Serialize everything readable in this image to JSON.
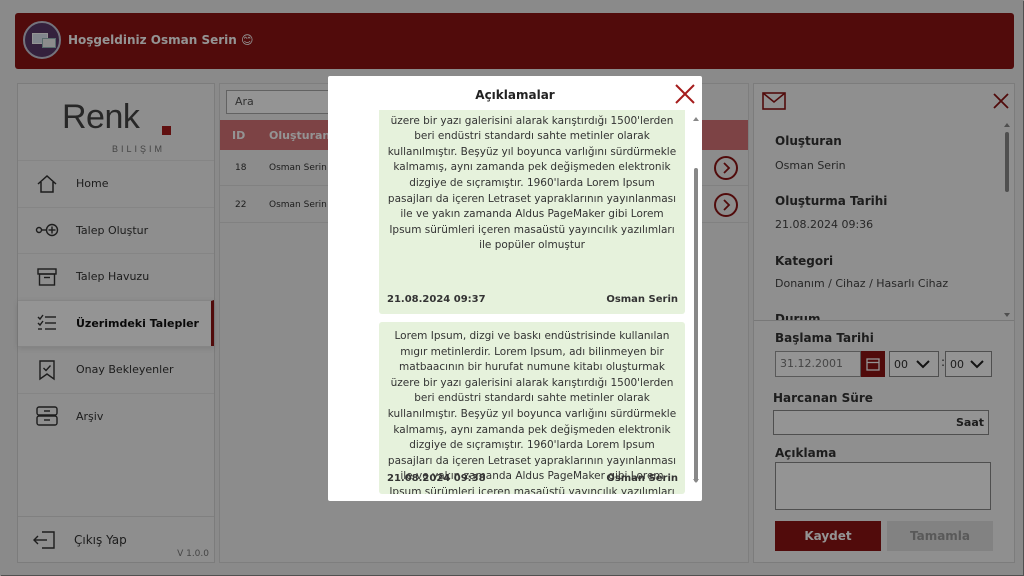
{
  "header": {
    "welcome": "Hoşgeldiniz Osman Serin 😊"
  },
  "logo": {
    "main": "Renk",
    "sub": "BILIŞIM"
  },
  "sidebar": {
    "items": [
      {
        "label": "Home",
        "icon": "home-icon"
      },
      {
        "label": "Talep Oluştur",
        "icon": "create-request-icon"
      },
      {
        "label": "Talep Havuzu",
        "icon": "archive-box-icon"
      },
      {
        "label": "Üzerimdeki Talepler",
        "icon": "task-list-icon",
        "active": true
      },
      {
        "label": "Onay Bekleyenler",
        "icon": "bookmark-check-icon"
      },
      {
        "label": "Arşiv",
        "icon": "inbox-stack-icon"
      }
    ],
    "logout": "Çıkış Yap",
    "version": "V 1.0.0"
  },
  "list": {
    "search_placeholder": "Ara",
    "columns": [
      "ID",
      "Oluşturan"
    ],
    "rows": [
      {
        "id": "18",
        "owner": "Osman Serin"
      },
      {
        "id": "22",
        "owner": "Osman Serin"
      }
    ]
  },
  "detail": {
    "creator_label": "Oluşturan",
    "creator_value": "Osman Serin",
    "created_label": "Oluşturma Tarihi",
    "created_value": "21.08.2024 09:36",
    "category_label": "Kategori",
    "category_value": "Donanım / Cihaz / Hasarlı Cihaz",
    "status_label": "Durum",
    "start_label": "Başlama Tarihi",
    "start_date": "31.12.2001",
    "hour": "00",
    "minute": "00",
    "spent_label": "Harcanan Süre",
    "spent_unit": "Saat",
    "note_label": "Açıklama",
    "save": "Kaydet",
    "complete": "Tamamla"
  },
  "modal": {
    "title": "Açıklamalar",
    "messages": [
      {
        "text": "matbaacının bir hurufat numune kitabı oluşturmak üzere bir yazı galerisini alarak karıştırdığı 1500'lerden beri endüstri standardı sahte metinler olarak kullanılmıştır. Beşyüz yıl boyunca varlığını sürdürmekle kalmamış, aynı zamanda pek değişmeden elektronik dizgiye de sıçramıştır. 1960'larda Lorem Ipsum pasajları da içeren Letraset yapraklarının yayınlanması ile ve yakın zamanda Aldus PageMaker gibi Lorem Ipsum sürümleri içeren masaüstü yayıncılık yazılımları ile popüler olmuştur",
        "date": "21.08.2024 09:37",
        "author": "Osman Serin"
      },
      {
        "text": "Lorem Ipsum, dizgi ve baskı endüstrisinde kullanılan mıgır metinlerdir. Lorem Ipsum, adı bilinmeyen bir matbaacının bir hurufat numune kitabı oluşturmak üzere bir yazı galerisini alarak karıştırdığı 1500'lerden beri endüstri standardı sahte metinler olarak kullanılmıştır. Beşyüz yıl boyunca varlığını sürdürmekle kalmamış, aynı zamanda pek değişmeden elektronik dizgiye de sıçramıştır. 1960'larda Lorem Ipsum pasajları da içeren Letraset yapraklarının yayınlanması ile ve yakın zamanda Aldus PageMaker gibi Lorem Ipsum sürümleri içeren masaüstü yayıncılık yazılımları ile popüler olmuştur",
        "date": "21.08.2024 09:38",
        "author": "Osman Serin"
      }
    ]
  },
  "colors": {
    "brand": "#8c1414",
    "table_header": "#d77478",
    "message_bg": "#e6f2dc"
  }
}
